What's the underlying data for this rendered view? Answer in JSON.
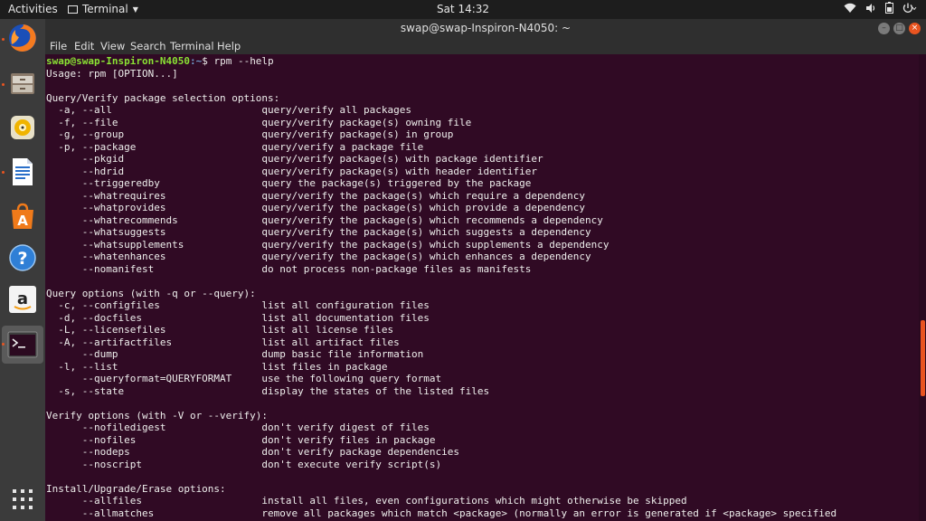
{
  "topbar": {
    "activities": "Activities",
    "app_menu": "Terminal",
    "clock": "Sat 14:32",
    "tray_icons": [
      "wifi-icon",
      "volume-icon",
      "battery-icon",
      "power-menu-icon"
    ]
  },
  "dock": {
    "apps": [
      "firefox",
      "files",
      "rhythmbox",
      "libreoffice-writer",
      "ubuntu-software",
      "help",
      "amazon",
      "terminal",
      "show-applications"
    ]
  },
  "window": {
    "title": "swap@swap-Inspiron-N4050: ~",
    "menu": [
      "File",
      "Edit",
      "View",
      "Search",
      "Terminal",
      "Help"
    ]
  },
  "terminal": {
    "prompt_user": "swap@swap-Inspiron-N4050",
    "prompt_path": ":~",
    "prompt_symbol": "$ ",
    "command": "rpm --help",
    "output": [
      "Usage: rpm [OPTION...]",
      "",
      "Query/Verify package selection options:",
      "  -a, --all                         query/verify all packages",
      "  -f, --file                        query/verify package(s) owning file",
      "  -g, --group                       query/verify package(s) in group",
      "  -p, --package                     query/verify a package file",
      "      --pkgid                       query/verify package(s) with package identifier",
      "      --hdrid                       query/verify package(s) with header identifier",
      "      --triggeredby                 query the package(s) triggered by the package",
      "      --whatrequires                query/verify the package(s) which require a dependency",
      "      --whatprovides                query/verify the package(s) which provide a dependency",
      "      --whatrecommends              query/verify the package(s) which recommends a dependency",
      "      --whatsuggests                query/verify the package(s) which suggests a dependency",
      "      --whatsupplements             query/verify the package(s) which supplements a dependency",
      "      --whatenhances                query/verify the package(s) which enhances a dependency",
      "      --nomanifest                  do not process non-package files as manifests",
      "",
      "Query options (with -q or --query):",
      "  -c, --configfiles                 list all configuration files",
      "  -d, --docfiles                    list all documentation files",
      "  -L, --licensefiles                list all license files",
      "  -A, --artifactfiles               list all artifact files",
      "      --dump                        dump basic file information",
      "  -l, --list                        list files in package",
      "      --queryformat=QUERYFORMAT     use the following query format",
      "  -s, --state                       display the states of the listed files",
      "",
      "Verify options (with -V or --verify):",
      "      --nofiledigest                don't verify digest of files",
      "      --nofiles                     don't verify files in package",
      "      --nodeps                      don't verify package dependencies",
      "      --noscript                    don't execute verify script(s)",
      "",
      "Install/Upgrade/Erase options:",
      "      --allfiles                    install all files, even configurations which might otherwise be skipped",
      "      --allmatches                  remove all packages which match <package> (normally an error is generated if <package> specified"
    ]
  },
  "colors": {
    "terminal_bg": "#300a24",
    "terminal_fg": "#eeeeec",
    "prompt_user": "#8ae234",
    "prompt_path": "#729fcf",
    "accent": "#e95420"
  }
}
